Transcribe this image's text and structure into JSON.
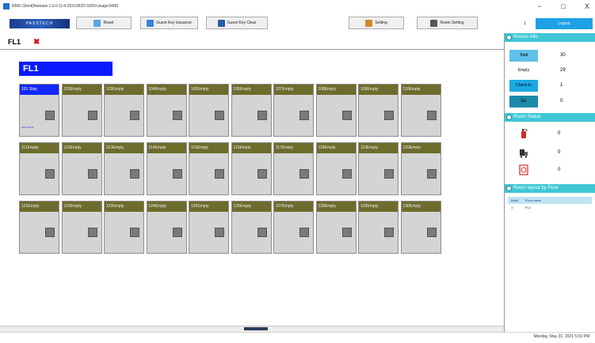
{
  "window": {
    "title": "RMS Client(Release 1.0.0.1)-4-2021052D-1650-Usage:RMS",
    "min": "−",
    "max": "□",
    "close": "X"
  },
  "toolbar": {
    "logo": "PASSTECH",
    "reset": "Reset",
    "guest_key_issuance": "Guest Key Issuance",
    "guest_key_clear": "Guest Key Clear",
    "setting": "Setting",
    "room_setting": "Room Setting",
    "user_count": "1",
    "logout": "Logout"
  },
  "tab": {
    "label": "FL1",
    "close": "✖"
  },
  "floor": {
    "title": "FL1"
  },
  "rooms": [
    {
      "label": "101  Stay",
      "status": "stay",
      "sub": "2021-05-20"
    },
    {
      "label": "102Empty",
      "status": "empty"
    },
    {
      "label": "103Empty",
      "status": "empty"
    },
    {
      "label": "104Empty",
      "status": "empty"
    },
    {
      "label": "105Empty",
      "status": "empty"
    },
    {
      "label": "106Empty",
      "status": "empty"
    },
    {
      "label": "107Empty",
      "status": "empty"
    },
    {
      "label": "108Empty",
      "status": "empty"
    },
    {
      "label": "109Empty",
      "status": "empty"
    },
    {
      "label": "110Empty",
      "status": "empty"
    },
    {
      "label": "111Empty",
      "status": "empty"
    },
    {
      "label": "112Empty",
      "status": "empty"
    },
    {
      "label": "113Empty",
      "status": "empty"
    },
    {
      "label": "114Empty",
      "status": "empty"
    },
    {
      "label": "115Empty",
      "status": "empty"
    },
    {
      "label": "116Empty",
      "status": "empty"
    },
    {
      "label": "117Empty",
      "status": "empty"
    },
    {
      "label": "118Empty",
      "status": "empty"
    },
    {
      "label": "119Empty",
      "status": "empty"
    },
    {
      "label": "120Empty",
      "status": "empty"
    },
    {
      "label": "121Empty",
      "status": "empty"
    },
    {
      "label": "122Empty",
      "status": "empty"
    },
    {
      "label": "123Empty",
      "status": "empty"
    },
    {
      "label": "124Empty",
      "status": "empty"
    },
    {
      "label": "125Empty",
      "status": "empty"
    },
    {
      "label": "126Empty",
      "status": "empty"
    },
    {
      "label": "127Empty",
      "status": "empty"
    },
    {
      "label": "128Empty",
      "status": "empty"
    },
    {
      "label": "129Empty",
      "status": "empty"
    },
    {
      "label": "130Empty",
      "status": "empty"
    }
  ],
  "rooms_info": {
    "title": "Rooms Info",
    "total_label": "Total",
    "total": "30",
    "empty_label": "Empty",
    "empty": "29",
    "checkin_label": "Check-in",
    "checkin": "1",
    "etc_label": "Etc",
    "etc": "0"
  },
  "room_status": {
    "title": "Room Status",
    "items": [
      {
        "icon": "fire-extinguisher-icon",
        "value": "0"
      },
      {
        "icon": "cleaning-cart-icon",
        "value": "0"
      },
      {
        "icon": "do-not-disturb-icon",
        "value": "0"
      }
    ]
  },
  "layout": {
    "title": "Room layout by Floor",
    "col_build": "Build",
    "col_floor": "Floor name",
    "rows": [
      {
        "build": "1",
        "floor": "FL1"
      }
    ]
  },
  "status": {
    "datetime": "Monday, May 31, 2021   5:03 PM"
  },
  "colors": {
    "accent": "#3fc7d5",
    "stay": "#1228ff",
    "empty_header": "#6e6c2c",
    "logout": "#1da1e6"
  }
}
